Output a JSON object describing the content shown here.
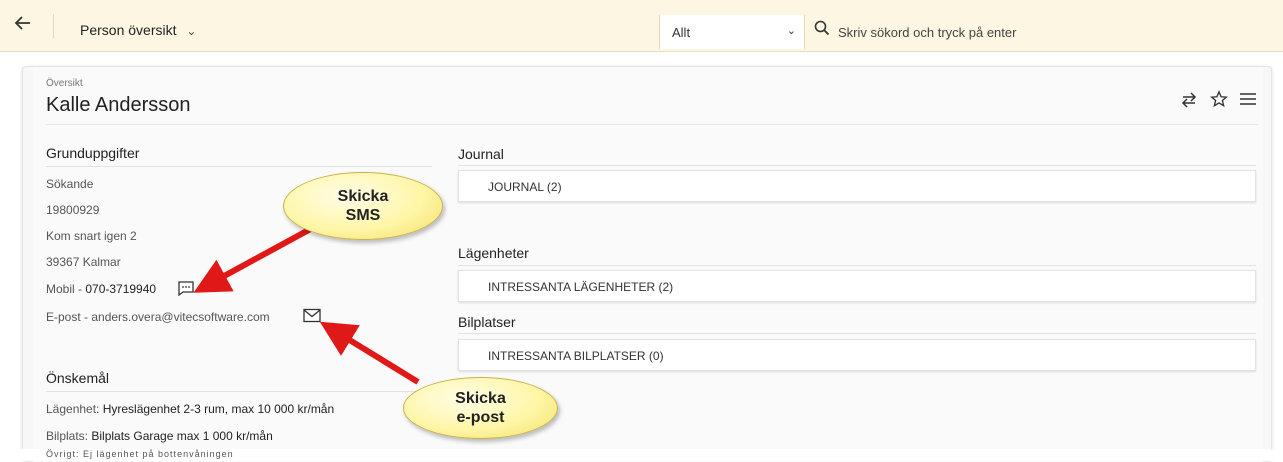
{
  "topbar": {
    "back_icon": "arrow-left-icon",
    "view_label": "Person översikt",
    "filter_value": "Allt",
    "search_placeholder": "Skriv sökord och tryck på enter"
  },
  "header": {
    "breadcrumb": "Översikt",
    "title": "Kalle Andersson",
    "actions": [
      "swap-icon",
      "star-icon",
      "menu-icon"
    ]
  },
  "grunduppgifter": {
    "title": "Grunduppgifter",
    "role": "Sökande",
    "personnummer": "19800929",
    "address": "Kom snart igen 2",
    "postal": "39367 Kalmar",
    "mobile_label": "Mobil - ",
    "mobile_value": "070-3719940",
    "email_label": "E-post - ",
    "email_value": "anders.overa@vitecsoftware.com"
  },
  "onskemal": {
    "title": "Önskemål",
    "apartment_label": "Lägenhet: ",
    "apartment_value": "Hyreslägenhet 2-3 rum, max 10 000 kr/mån",
    "parking_label": "Bilplats: ",
    "parking_value": "Bilplats Garage max 1 000 kr/mån",
    "other_partial": "Övrigt: Ej lägenhet på bottenvåningen"
  },
  "journal": {
    "title": "Journal",
    "row": "JOURNAL (2)"
  },
  "lagenheter": {
    "title": "Lägenheter",
    "row": "INTRESSANTA LÄGENHETER (2)"
  },
  "bilplatser": {
    "title": "Bilplatser",
    "row": "INTRESSANTA BILPLATSER (0)"
  },
  "callouts": {
    "sms_line1": "Skicka",
    "sms_line2": "SMS",
    "email_line1": "Skicka",
    "email_line2": "e-post",
    "color": "#fff6a8",
    "arrow_color": "#e01818"
  }
}
